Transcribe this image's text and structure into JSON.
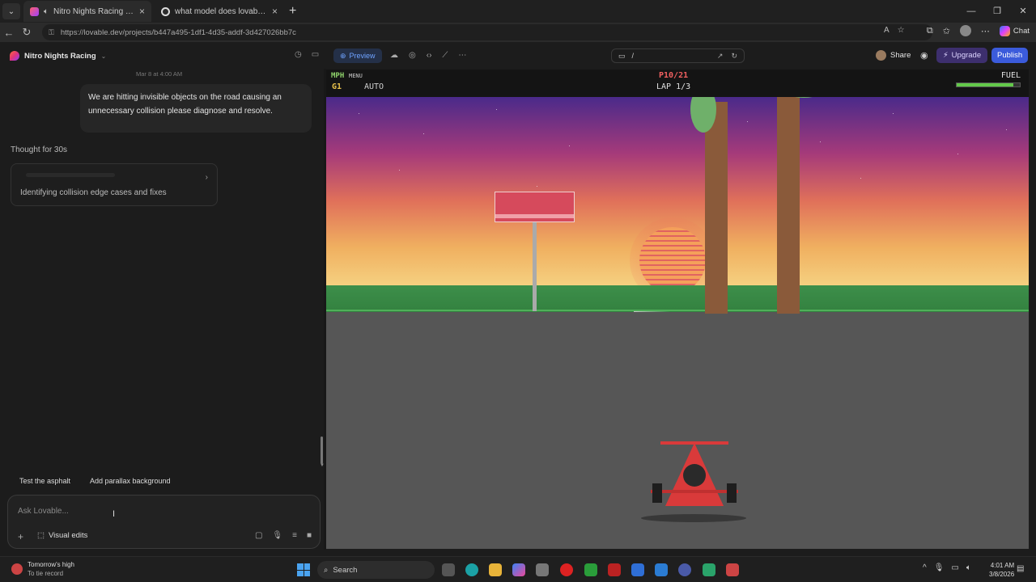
{
  "browser": {
    "tabs": [
      {
        "title": "Nitro Nights Racing - Lovable",
        "active": true
      },
      {
        "title": "what model does lovable use - Go",
        "active": false
      }
    ],
    "url": "https://lovable.dev/projects/b447a495-1df1-4d35-addf-3d427026bb7c",
    "copilot_label": "Chat"
  },
  "app": {
    "project_name": "Nitro Nights Racing",
    "preview_label": "Preview",
    "route": "/",
    "share_label": "Share",
    "upgrade_label": "Upgrade",
    "publish_label": "Publish"
  },
  "chat": {
    "timestamp": "Mar 8 at 4:00 AM",
    "user_message": "We are hitting invisible objects on the road causing an unnecessary collision please diagnose and resolve.",
    "thought_label": "Thought for 30s",
    "task_card_text": "Identifying collision edge cases and fixes",
    "suggestions": [
      "Test the asphalt",
      "Add parallax background"
    ],
    "input_placeholder": "Ask Lovable...",
    "visual_edits_label": "Visual edits"
  },
  "game": {
    "speed_unit": "MPH",
    "menu_label": "MENU",
    "gear": "G1",
    "transmission": "AUTO",
    "position": "P10/21",
    "lap": "LAP 1/3",
    "fuel_label": "FUEL",
    "fuel_level": 0.9,
    "colors": {
      "hud_bg": "#141414",
      "car": "#d93a3a",
      "road": "#565656"
    }
  },
  "taskbar": {
    "weather_title": "Tomorrow's high",
    "weather_sub": "To tie record",
    "search_label": "Search",
    "time": "4:01 AM",
    "date": "3/8/2026"
  }
}
